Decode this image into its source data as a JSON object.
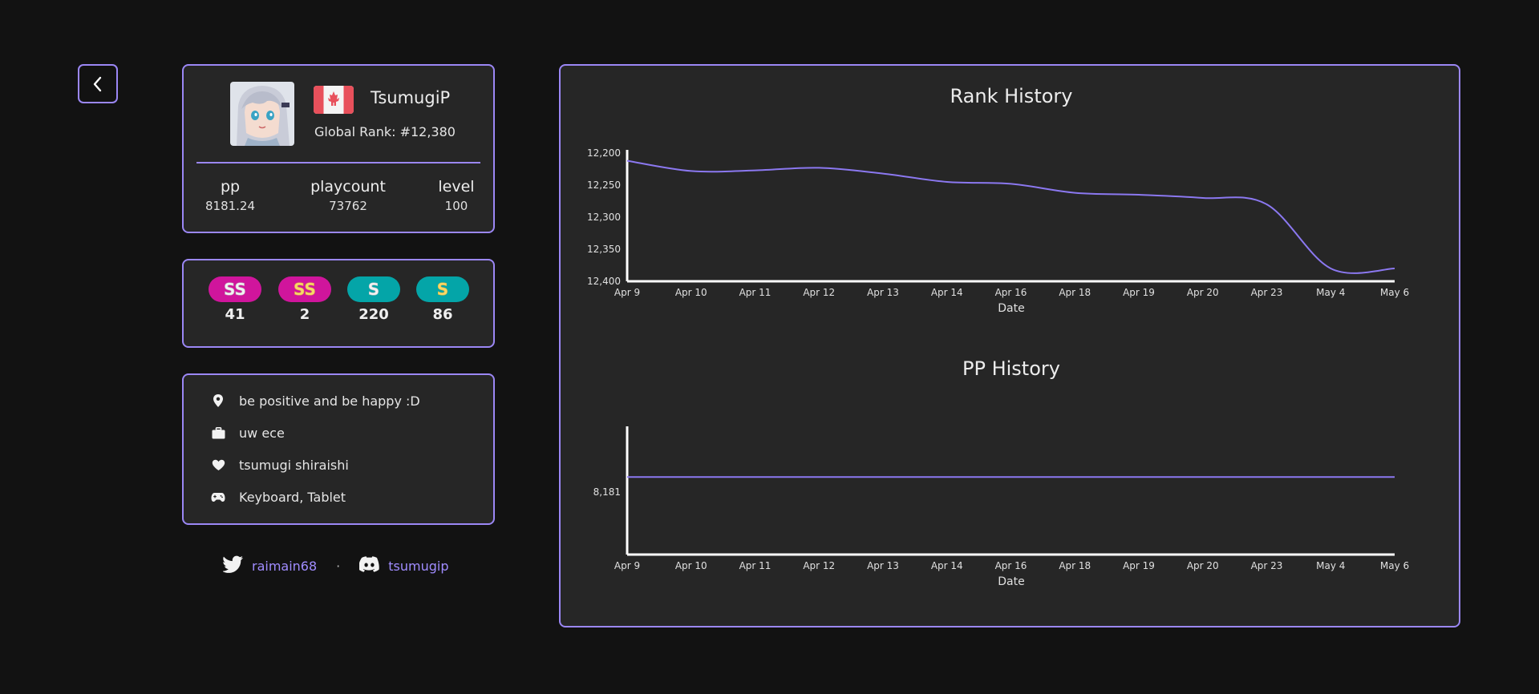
{
  "profile": {
    "username": "TsumugiP",
    "global_rank": "Global Rank: #12,380",
    "country_flag": "canada-flag-icon",
    "stats": [
      {
        "label": "pp",
        "value": "8181.24"
      },
      {
        "label": "playcount",
        "value": "73762"
      },
      {
        "label": "level",
        "value": "100"
      }
    ]
  },
  "grades": [
    {
      "grade": "SS",
      "variant": "silver",
      "count": "41",
      "color": "#d0159c"
    },
    {
      "grade": "SS",
      "variant": "gold",
      "count": "2",
      "color": "#d0159c"
    },
    {
      "grade": "S",
      "variant": "silver",
      "count": "220",
      "color": "#04a5a8"
    },
    {
      "grade": "S",
      "variant": "gold",
      "count": "86",
      "color": "#04a5a8"
    }
  ],
  "info": [
    {
      "icon": "location-pin-icon",
      "text": "be positive and be happy :D"
    },
    {
      "icon": "briefcase-icon",
      "text": "uw ece"
    },
    {
      "icon": "heart-icon",
      "text": "tsumugi shiraishi"
    },
    {
      "icon": "gamepad-icon",
      "text": "Keyboard, Tablet"
    }
  ],
  "socials": {
    "twitter": "raimain68",
    "discord": "tsumugip",
    "separator": "·"
  },
  "colors": {
    "accent": "#9b87f5",
    "background": "#121212",
    "card": "#262626",
    "line": "#8b78f0",
    "link": "#a08cff"
  },
  "chart_data": [
    {
      "type": "line",
      "title": "Rank History",
      "xlabel": "Date",
      "ylabel": "",
      "categories": [
        "Apr 9",
        "Apr 10",
        "Apr 11",
        "Apr 12",
        "Apr 13",
        "Apr 14",
        "Apr 16",
        "Apr 18",
        "Apr 19",
        "Apr 20",
        "Apr 23",
        "May 4",
        "May 6"
      ],
      "yticks": [
        "12,200",
        "12,250",
        "12,300",
        "12,350",
        "12,400"
      ],
      "ylim": [
        12200,
        12400
      ],
      "y_inverted": true,
      "series": [
        {
          "values": [
            12212,
            12228,
            12227,
            12223,
            12232,
            12245,
            12248,
            12262,
            12265,
            12270,
            12280,
            12380,
            12380
          ]
        }
      ]
    },
    {
      "type": "line",
      "title": "PP History",
      "xlabel": "Date",
      "ylabel": "",
      "categories": [
        "Apr 9",
        "Apr 10",
        "Apr 11",
        "Apr 12",
        "Apr 13",
        "Apr 14",
        "Apr 16",
        "Apr 18",
        "Apr 19",
        "Apr 20",
        "Apr 23",
        "May 4",
        "May 6"
      ],
      "yticks": [
        "8,181"
      ],
      "ylim": [
        8180,
        8182
      ],
      "series": [
        {
          "values": [
            8181.24,
            8181.24,
            8181.24,
            8181.24,
            8181.24,
            8181.24,
            8181.24,
            8181.24,
            8181.24,
            8181.24,
            8181.24,
            8181.24,
            8181.24
          ]
        }
      ]
    }
  ]
}
